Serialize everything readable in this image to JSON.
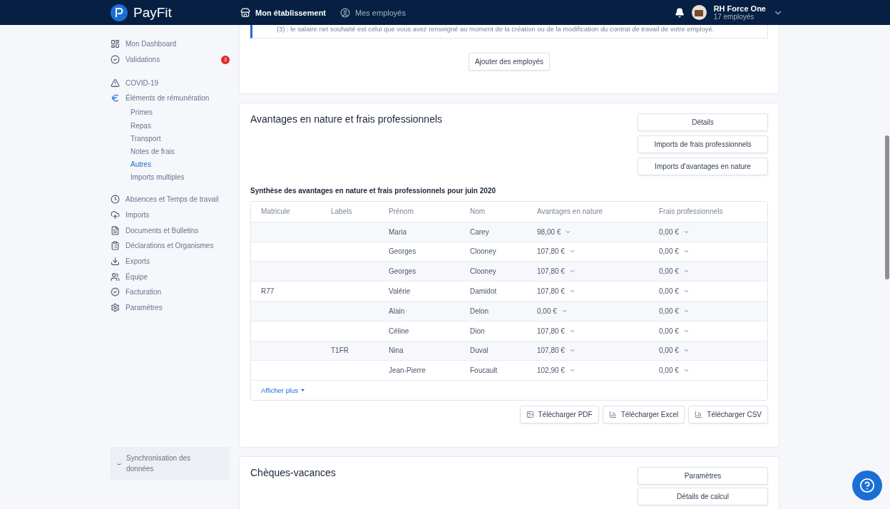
{
  "header": {
    "brand": "PayFit",
    "nav": [
      {
        "label": "Mon établissement",
        "selected": true
      },
      {
        "label": "Mes employés",
        "selected": false
      }
    ],
    "account": {
      "name": "RH Force One",
      "subtitle": "17 employés"
    }
  },
  "sidebar": {
    "groups": [
      [
        {
          "label": "Mon Dashboard",
          "expanded": false
        },
        {
          "label": "Validations",
          "badge": "3",
          "expanded": false
        }
      ],
      [
        {
          "label": "COVID-19",
          "expanded": false
        },
        {
          "label": "Éléments de rémunération",
          "expanded": true,
          "children": [
            {
              "label": "Primes",
              "selected": false
            },
            {
              "label": "Repas",
              "selected": false
            },
            {
              "label": "Transport",
              "selected": false
            },
            {
              "label": "Notes de frais",
              "selected": false
            },
            {
              "label": "Autres",
              "selected": true
            },
            {
              "label": "Imports multiples",
              "selected": false
            }
          ]
        }
      ],
      [
        {
          "label": "Absences et Temps de travail",
          "expanded": false
        },
        {
          "label": "Imports",
          "expanded": false
        },
        {
          "label": "Documents et Bulletins",
          "expanded": false
        },
        {
          "label": "Déclarations et Organismes",
          "expanded": false
        },
        {
          "label": "Exports",
          "expanded": false
        },
        {
          "label": "Équipe",
          "expanded": false
        },
        {
          "label": "Facturation",
          "expanded": false
        },
        {
          "label": "Paramètres",
          "expanded": false
        }
      ]
    ],
    "sync": "Synchronisation des données"
  },
  "top_card": {
    "note": "(3) : le salaire net souhaité est celui que vous avez renseigné au moment de la création ou de la modification du contrat de travail de votre employé.",
    "button": "Ajouter des employés"
  },
  "benefits_card": {
    "title": "Avantages en nature et frais professionnels",
    "buttons": [
      "Détails",
      "Imports de frais professionnels",
      "Imports d'avantages en nature"
    ],
    "table_title": "Synthèse des avantages en nature et frais professionnels pour juin 2020",
    "table": {
      "columns": [
        "Matricule",
        "Labels",
        "Prénom",
        "Nom",
        "Avantages en nature",
        "Frais professionnels"
      ],
      "rows": [
        [
          "",
          "",
          "Maria",
          "Carey",
          "98,00 €",
          "0,00 €"
        ],
        [
          "",
          "",
          "Georges",
          "Clooney",
          "107,80 €",
          "0,00 €"
        ],
        [
          "",
          "",
          "Georges",
          "Clooney",
          "107,80 €",
          "0,00 €"
        ],
        [
          "R77",
          "",
          "Valérie",
          "Damidot",
          "107,80 €",
          "0,00 €"
        ],
        [
          "",
          "",
          "Alain",
          "Delon",
          "0,00 €",
          "0,00 €"
        ],
        [
          "",
          "",
          "Céline",
          "Dion",
          "107,80 €",
          "0,00 €"
        ],
        [
          "",
          "T1FR",
          "Nina",
          "Duval",
          "107,80 €",
          "0,00 €"
        ],
        [
          "",
          "",
          "Jean-Pierre",
          "Foucault",
          "102,90 €",
          "0,00 €"
        ]
      ],
      "more": "Afficher plus"
    },
    "downloads": [
      "Télécharger PDF",
      "Télécharger Excel",
      "Télécharger CSV"
    ]
  },
  "vacation_card": {
    "title": "Chèques-vacances",
    "buttons": [
      "Paramètres",
      "Détails de calcul"
    ]
  }
}
